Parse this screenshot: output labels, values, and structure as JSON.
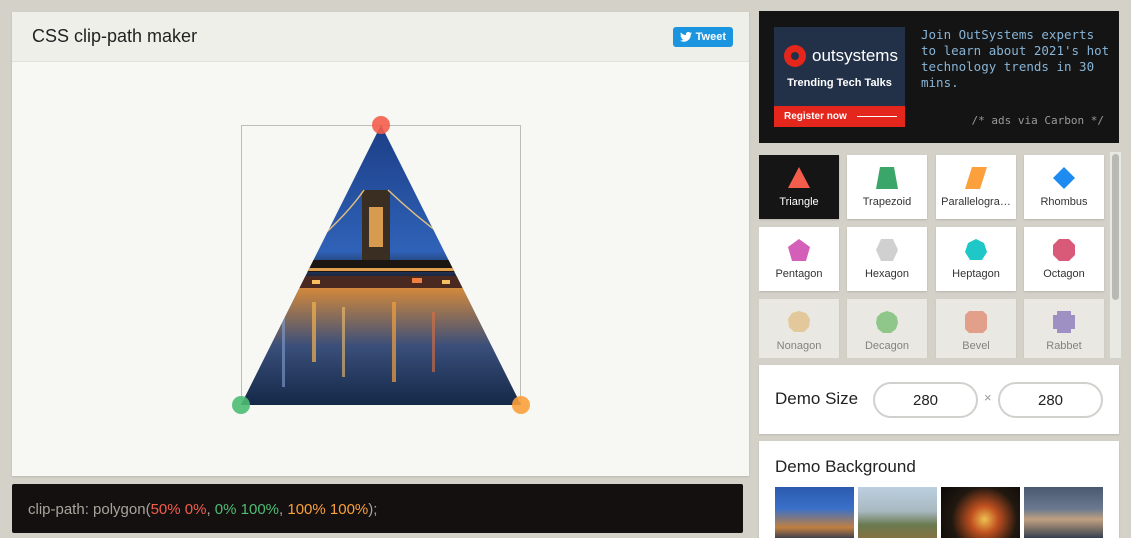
{
  "editor": {
    "title": "CSS clip-path maker",
    "tweet_label": "Tweet"
  },
  "code": {
    "prefix": "clip-path: polygon(",
    "point1": "50% 0%",
    "sep1": ", ",
    "point2": "0% 100%",
    "sep2": ", ",
    "point3": "100% 100%",
    "suffix": ");"
  },
  "ad": {
    "brand": "outsystems",
    "tagline": "Trending Tech Talks",
    "cta": "Register now",
    "text": "Join OutSystems experts to learn about 2021's hot technology trends in 30 mins.",
    "via": "/* ads via Carbon */"
  },
  "shapes": [
    {
      "label": "Triangle",
      "color": "#f45d4c",
      "icon": "triangle-icon",
      "active": true
    },
    {
      "label": "Trapezoid",
      "color": "#3aa66a",
      "icon": "trapezoid-icon"
    },
    {
      "label": "Parallelogra…",
      "color": "#fba03c",
      "icon": "parallelogram-icon"
    },
    {
      "label": "Rhombus",
      "color": "#1e8bf0",
      "icon": "rhombus-icon"
    },
    {
      "label": "Pentagon",
      "color": "#d45fb8",
      "icon": "pentagon-icon"
    },
    {
      "label": "Hexagon",
      "color": "#d0d0d0",
      "icon": "hexagon-icon"
    },
    {
      "label": "Heptagon",
      "color": "#1fc7c7",
      "icon": "heptagon-icon"
    },
    {
      "label": "Octagon",
      "color": "#d85a78",
      "icon": "octagon-icon"
    },
    {
      "label": "Nonagon",
      "color": "#f0c070",
      "icon": "nonagon-icon"
    },
    {
      "label": "Decagon",
      "color": "#4dbd4d",
      "icon": "decagon-icon"
    },
    {
      "label": "Bevel",
      "color": "#f07050",
      "icon": "bevel-icon"
    },
    {
      "label": "Rabbet",
      "color": "#6a50c0",
      "icon": "rabbet-icon"
    }
  ],
  "demo_size": {
    "label": "Demo Size",
    "width": "280",
    "height": "280",
    "separator": "×"
  },
  "demo_background": {
    "label": "Demo Background"
  },
  "handles": {
    "top_color": "#f45d4c",
    "left_color": "#4dbd74",
    "right_color": "#fba03c"
  }
}
